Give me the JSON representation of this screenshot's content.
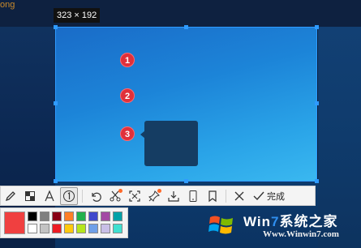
{
  "desktop": {
    "corner_text": "ong"
  },
  "capture": {
    "size_label": "323 × 192"
  },
  "markers": [
    "1",
    "2",
    "3"
  ],
  "toolbar": {
    "tools": [
      {
        "name": "pencil-icon"
      },
      {
        "name": "mosaic-icon"
      },
      {
        "name": "text-icon"
      },
      {
        "name": "number-marker-icon",
        "active": true
      },
      {
        "name": "undo-icon"
      },
      {
        "name": "cutout-icon",
        "badge": true
      },
      {
        "name": "fullscreen-capture-icon"
      },
      {
        "name": "pin-icon",
        "badge": true
      },
      {
        "name": "download-icon"
      },
      {
        "name": "mobile-icon"
      },
      {
        "name": "bookmark-icon"
      },
      {
        "name": "close-icon"
      }
    ],
    "finish_label": "完成"
  },
  "palette": {
    "current": "#f04040",
    "colors": [
      "#000000",
      "#7f7f7f",
      "#880015",
      "#ff7f27",
      "#22b14c",
      "#3f48cc",
      "#a349a4",
      "#00a2a8",
      "#ffffff",
      "#c3c3c3",
      "#ed1c24",
      "#ffc90e",
      "#b5e61d",
      "#6fa0e8",
      "#c8bfe7",
      "#40e0d0"
    ]
  },
  "watermark": {
    "brand_prefix": "Win",
    "brand_number": "7",
    "brand_suffix": "系统之家",
    "url": "Www.Winwin7.com"
  }
}
